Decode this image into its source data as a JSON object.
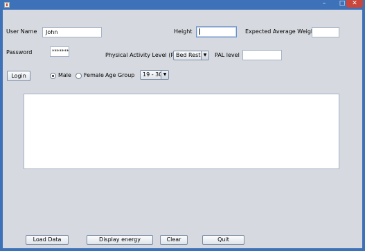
{
  "window": {
    "minimize_glyph": "–",
    "maximize_glyph": "□",
    "close_glyph": "✕"
  },
  "form": {
    "username_label": "User Name",
    "username_value": "John",
    "password_label": "Password",
    "password_value": "*******",
    "height_label": "Height",
    "height_value": "",
    "eaw_label": "Expected Average Weight",
    "eaw_value": "",
    "pal_label": "Physical Activity Level (PAL)",
    "pal_selected": "Bed Rest",
    "pal_level_label": "PAL level",
    "pal_level_value": "",
    "login_button": "Login",
    "gender_male": "Male",
    "gender_female": "Female",
    "gender_selected": "Male",
    "age_group_label": "Age Group",
    "age_group_selected": "19 - 30"
  },
  "output": {
    "text": ""
  },
  "buttons": {
    "load_data": "Load Data",
    "display_energy": "Display energy",
    "clear": "Clear",
    "quit": "Quit"
  },
  "icons": {
    "dropdown_arrow": "▼"
  }
}
